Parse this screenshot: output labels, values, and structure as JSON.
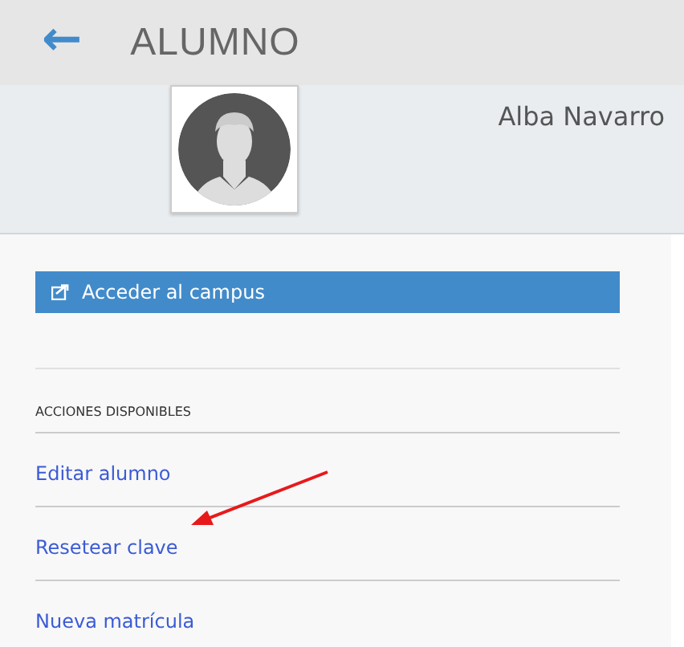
{
  "header": {
    "back_icon": "←",
    "title": "ALUMNO"
  },
  "profile": {
    "name": "Alba Navarro"
  },
  "campus_button": {
    "label": "Acceder al campus"
  },
  "actions": {
    "heading": "ACCIONES DISPONIBLES",
    "items": [
      {
        "label": "Editar alumno"
      },
      {
        "label": "Resetear clave"
      },
      {
        "label": "Nueva matrícula"
      }
    ]
  }
}
